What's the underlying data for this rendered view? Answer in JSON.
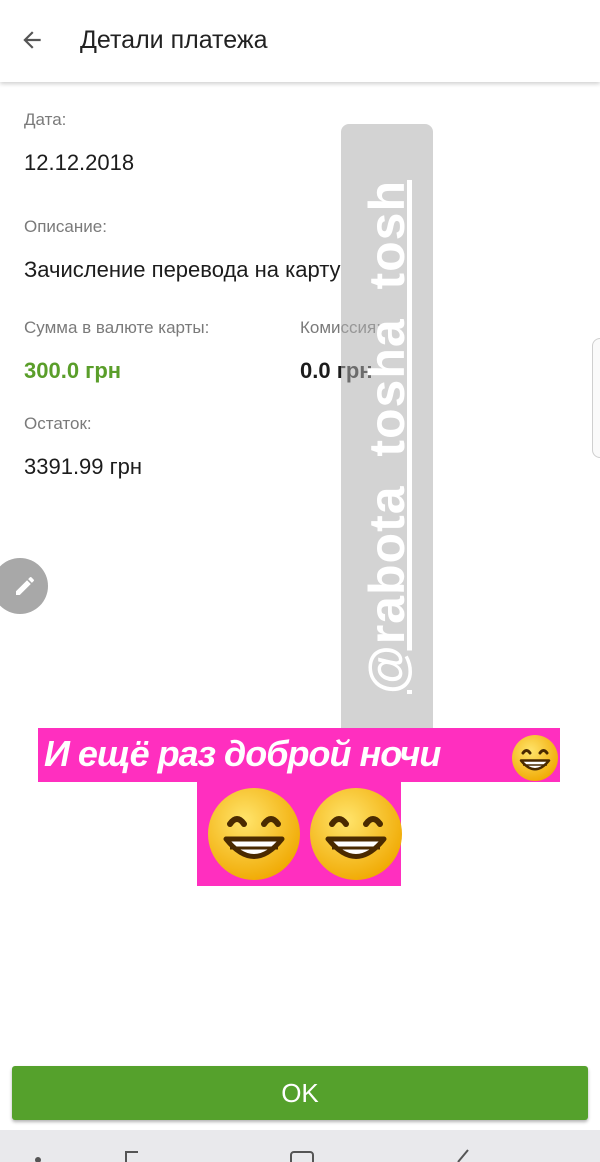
{
  "appbar": {
    "title": "Детали платежа",
    "back_icon": "arrow-left-icon"
  },
  "details": {
    "date_label": "Дата:",
    "date_value": "12.12.2018",
    "description_label": "Описание:",
    "description_value": "Зачисление перевода на карту",
    "amount_label": "Сумма в валюте карты:",
    "amount_value": "300.0 грн",
    "commission_label": "Комиссия:",
    "commission_value": "0.0 грн",
    "balance_label": "Остаток:",
    "balance_value": "3391.99 грн"
  },
  "edit_fab": {
    "icon": "pencil-icon"
  },
  "watermark": {
    "text": "@rabota_tosha_tosh"
  },
  "sticker": {
    "text": "И ещё раз доброй ночи"
  },
  "actions": {
    "ok_label": "OK"
  },
  "colors": {
    "accent": "#55a12c",
    "amount": "#5a9e2a",
    "sticker_bg": "#ff2fbf"
  }
}
